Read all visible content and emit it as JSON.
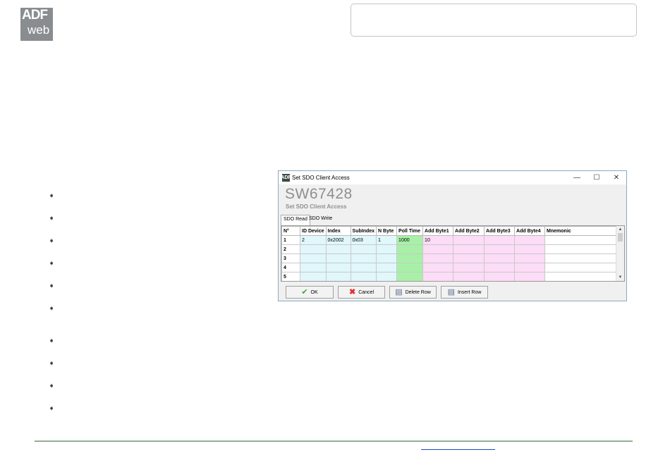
{
  "logo": {
    "line1": "ADF",
    "line2": "web"
  },
  "window": {
    "title": "Set SDO Client Access",
    "app_icon_text": "ADF",
    "controls": {
      "minimize": "—",
      "maximize": "☐",
      "close": "✕"
    },
    "banner_code": "SW67428",
    "banner_subtitle": "Set SDO Client Access",
    "tabs": [
      "SDO Read",
      "SDO Write"
    ],
    "table": {
      "headers": [
        "N°",
        "ID Device",
        "Index",
        "SubIndex",
        "N Byte",
        "Poll Time",
        "Add Byte1",
        "Add Byte2",
        "Add Byte3",
        "Add Byte4",
        "Mnemonic"
      ],
      "rows": [
        [
          "1",
          "2",
          "0x2002",
          "0x03",
          "1",
          "1000",
          "10",
          "",
          "",
          "",
          ""
        ],
        [
          "2",
          "",
          "",
          "",
          "",
          "",
          "",
          "",
          "",
          "",
          ""
        ],
        [
          "3",
          "",
          "",
          "",
          "",
          "",
          "",
          "",
          "",
          "",
          ""
        ],
        [
          "4",
          "",
          "",
          "",
          "",
          "",
          "",
          "",
          "",
          "",
          ""
        ],
        [
          "5",
          "",
          "",
          "",
          "",
          "",
          "",
          "",
          "",
          "",
          ""
        ]
      ]
    },
    "buttons": {
      "ok": "OK",
      "cancel": "Cancel",
      "delete_row": "Delete Row",
      "insert_row": "Insert Row"
    }
  },
  "bullet_symbol": "➧",
  "colors": {
    "id_cols": "#e0f7fc",
    "poll_time": "#a8f0a8",
    "add_bytes": "#fcdcf6",
    "footer_line": "#2e6b3a",
    "link": "#1a44c8"
  }
}
